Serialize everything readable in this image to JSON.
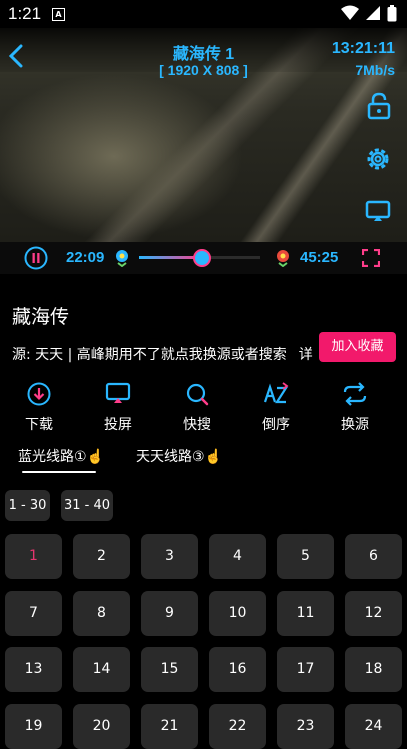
{
  "status_bar": {
    "time": "1:21",
    "notif_letter": "A"
  },
  "player": {
    "title": "藏海传 1",
    "resolution": "[ 1920 X 808 ]",
    "clock": "13:21:11",
    "speed": "7Mb/s",
    "elapsed": "22:09",
    "duration": "45:25",
    "progress_fraction": 0.52
  },
  "show": {
    "title": "藏海传",
    "source_line": "源: 天天 | 高峰期用不了就点我换源或者搜索",
    "source_overflow": "详",
    "favorite_label": "加入收藏"
  },
  "actions": [
    {
      "label": "下载",
      "icon": "download-icon"
    },
    {
      "label": "投屏",
      "icon": "cast-icon"
    },
    {
      "label": "快搜",
      "icon": "search-icon"
    },
    {
      "label": "倒序",
      "icon": "sort-az-icon"
    },
    {
      "label": "换源",
      "icon": "switch-source-icon"
    }
  ],
  "tabs": [
    {
      "label": "蓝光线路①☝️",
      "active": true
    },
    {
      "label": "天天线路③☝️",
      "active": false
    }
  ],
  "ranges": [
    "1 - 30",
    "31 - 40"
  ],
  "episodes": [
    "1",
    "2",
    "3",
    "4",
    "5",
    "6",
    "7",
    "8",
    "9",
    "10",
    "11",
    "12",
    "13",
    "14",
    "15",
    "16",
    "17",
    "18",
    "19",
    "20",
    "21",
    "22",
    "23",
    "24"
  ],
  "current_episode": "1",
  "colors": {
    "accent": "#2ab7ff",
    "favorite": "#f2196b",
    "current_episode": "#e5356f"
  }
}
